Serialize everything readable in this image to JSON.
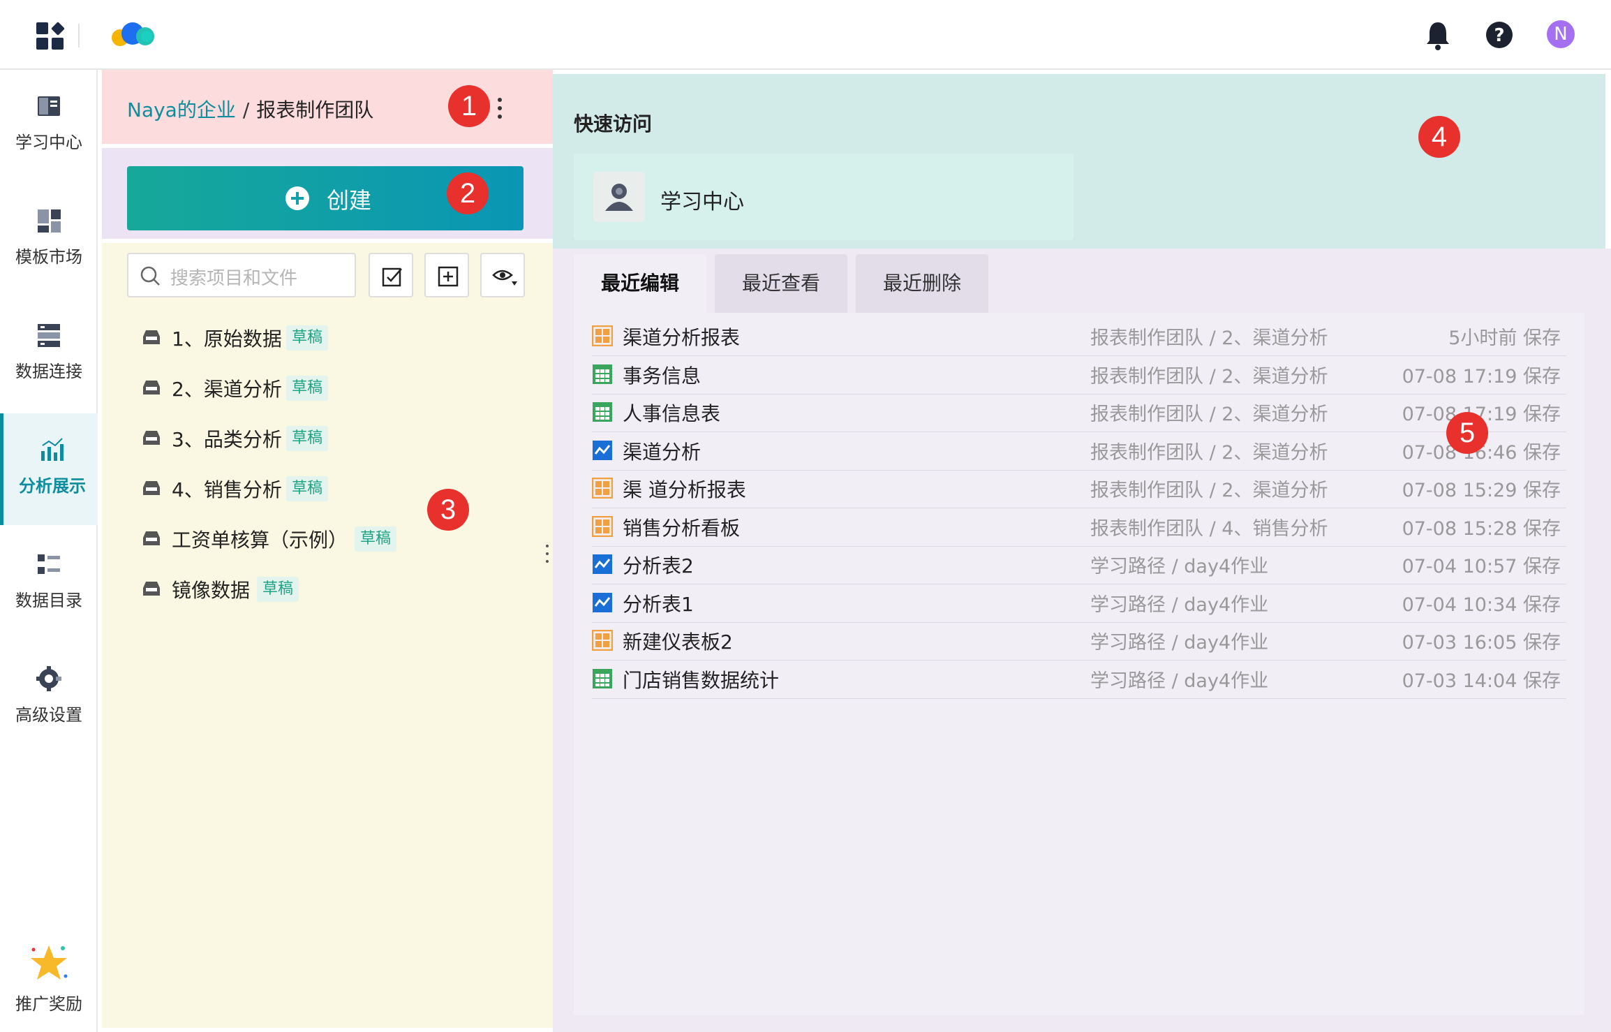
{
  "topbar": {
    "avatar_initial": "N",
    "icons": [
      "apps-icon",
      "logo",
      "bell-icon",
      "help-icon"
    ]
  },
  "nav": {
    "items": [
      {
        "label": "学习中心",
        "icon": "book-icon"
      },
      {
        "label": "模板市场",
        "icon": "template-icon"
      },
      {
        "label": "数据连接",
        "icon": "database-icon"
      },
      {
        "label": "分析展示",
        "icon": "chart-icon",
        "active": true
      },
      {
        "label": "数据目录",
        "icon": "catalog-icon"
      },
      {
        "label": "高级设置",
        "icon": "gear-icon"
      }
    ],
    "reward_label": "推广奖励"
  },
  "breadcrumb": {
    "org": "Naya的企业",
    "sep": "/",
    "team": "报表制作团队"
  },
  "create": {
    "label": "创建"
  },
  "search": {
    "placeholder": "搜索项目和文件"
  },
  "tree": [
    {
      "label": "1、原始数据",
      "badge": "草稿"
    },
    {
      "label": "2、渠道分析",
      "badge": "草稿"
    },
    {
      "label": "3、品类分析",
      "badge": "草稿"
    },
    {
      "label": "4、销售分析",
      "badge": "草稿"
    },
    {
      "label": "工资单核算（示例）",
      "badge": "草稿"
    },
    {
      "label": "镜像数据",
      "badge": "草稿"
    }
  ],
  "quick": {
    "title": "快速访问",
    "card_label": "学习中心"
  },
  "tabs": [
    {
      "label": "最近编辑",
      "active": true
    },
    {
      "label": "最近查看",
      "active": false
    },
    {
      "label": "最近删除",
      "active": false
    }
  ],
  "recent": [
    {
      "name": "渠道分析报表",
      "type": "dashboard",
      "path": "报表制作团队 / 2、渠道分析",
      "time": "5小时前 保存"
    },
    {
      "name": "事务信息",
      "type": "table",
      "path": "报表制作团队 / 2、渠道分析",
      "time": "07-08 17:19 保存"
    },
    {
      "name": "人事信息表",
      "type": "table",
      "path": "报表制作团队 / 2、渠道分析",
      "time": "07-08 17:19 保存"
    },
    {
      "name": "渠道分析",
      "type": "analysis",
      "path": "报表制作团队 / 2、渠道分析",
      "time": "07-08 16:46 保存"
    },
    {
      "name": "渠 道分析报表",
      "type": "dashboard",
      "path": "报表制作团队 / 2、渠道分析",
      "time": "07-08 15:29 保存"
    },
    {
      "name": "销售分析看板",
      "type": "dashboard",
      "path": "报表制作团队 / 4、销售分析",
      "time": "07-08 15:28 保存"
    },
    {
      "name": "分析表2",
      "type": "analysis",
      "path": "学习路径 / day4作业",
      "time": "07-04 10:57 保存"
    },
    {
      "name": "分析表1",
      "type": "analysis",
      "path": "学习路径 / day4作业",
      "time": "07-04 10:34 保存"
    },
    {
      "name": "新建仪表板2",
      "type": "dashboard",
      "path": "学习路径 / day4作业",
      "time": "07-03 16:05 保存"
    },
    {
      "name": "门店销售数据统计",
      "type": "table",
      "path": "学习路径 / day4作业",
      "time": "07-03 14:04 保存"
    }
  ],
  "markers": [
    "1",
    "2",
    "3",
    "4",
    "5"
  ],
  "colors": {
    "accent": "#0d8d9d",
    "marker": "#e8312d",
    "draft_badge": "#1fa384",
    "dashboard_icon": "#f0a040",
    "table_icon": "#3aa55d",
    "analysis_icon": "#1a6fd6"
  }
}
